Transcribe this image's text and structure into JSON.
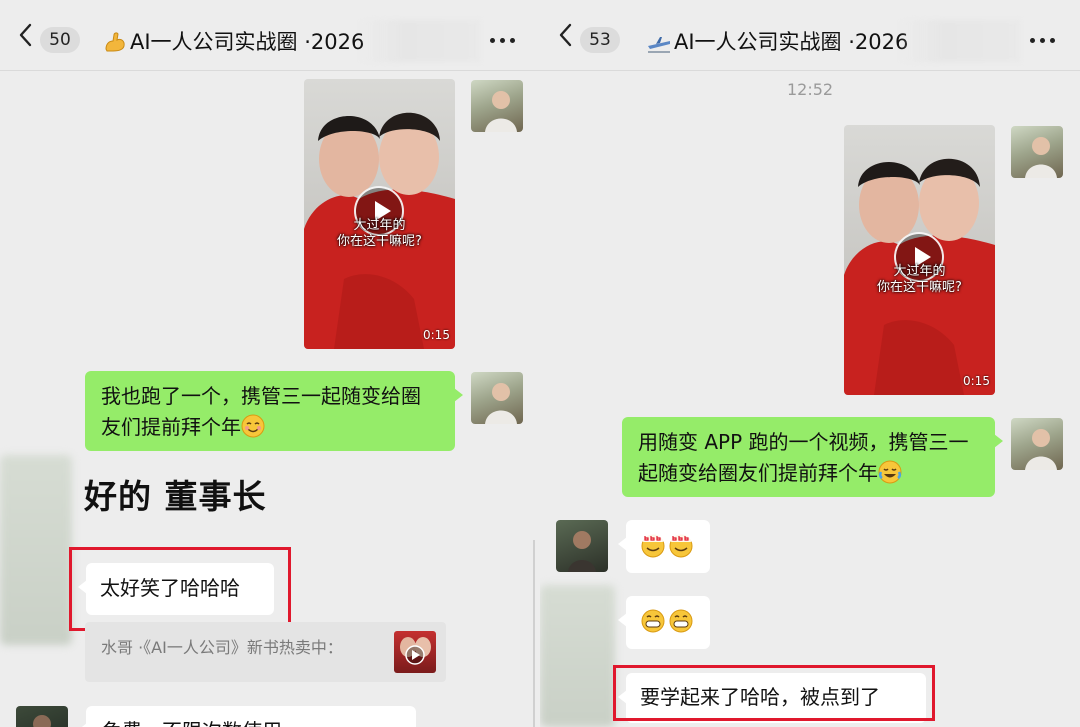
{
  "left": {
    "header": {
      "unread_count": "50",
      "title": "AI一人公司实战圈 ·2026"
    },
    "video": {
      "caption_line1": "大过年的",
      "caption_line2": "你在这干嘛呢?",
      "duration": "0:15"
    },
    "message_green": "我也跑了一个，携管三一起随变给圈友们提前拜个年",
    "message_big": "好的  董事长",
    "message_highlight": "太好笑了哈哈哈",
    "quote": "水哥 ·《AI一人公司》新书热卖中：",
    "message_partial": "免费，不限次数使用"
  },
  "right": {
    "header": {
      "unread_count": "53",
      "title": "AI一人公司实战圈 ·2026"
    },
    "time": "12:52",
    "video": {
      "caption_line1": "大过年的",
      "caption_line2": "你在这干嘛呢?",
      "duration": "0:15"
    },
    "message_green": "用随变 APP 跑的一个视频，携管三一起随变给圈友们提前拜个年",
    "message_highlight": "要学起来了哈哈，被点到了"
  },
  "colors": {
    "chat_background": "#ededed",
    "self_bubble": "#95ec69",
    "other_bubble": "#ffffff",
    "highlight": "#e0182d"
  },
  "icons": [
    "back-icon",
    "more-icon",
    "play-icon",
    "flexed-biceps-icon",
    "airplane-icon",
    "blush-emoji-icon",
    "tears-of-joy-emoji-icon",
    "666-emoji-icon",
    "grin-emoji-icon"
  ]
}
